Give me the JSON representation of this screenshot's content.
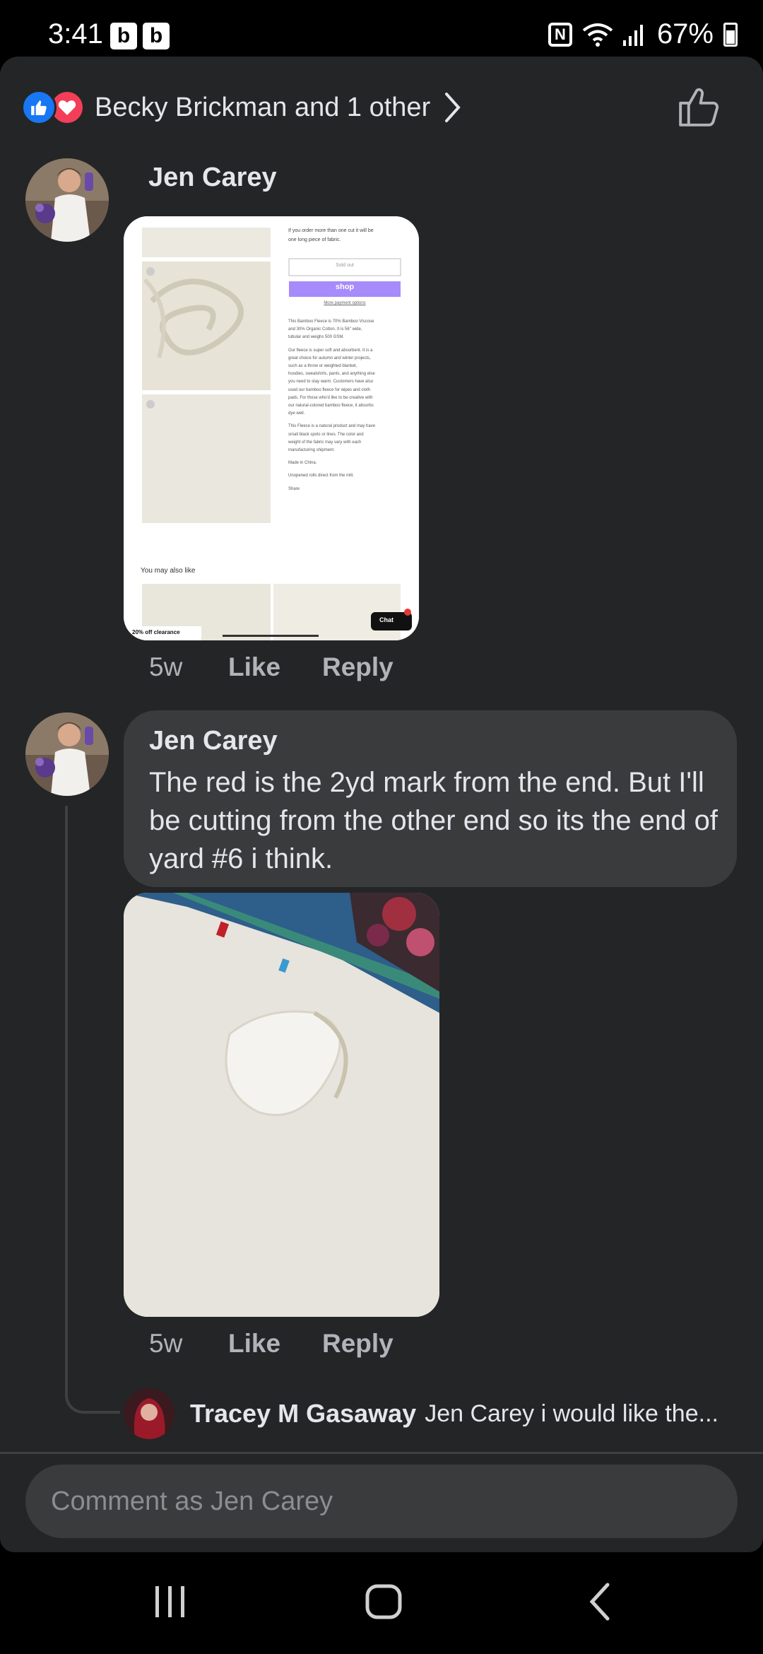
{
  "status_bar": {
    "time": "3:41",
    "badges": [
      "b",
      "b"
    ],
    "nfc": "N",
    "battery": "67%"
  },
  "header": {
    "reactions_text": "Becky Brickman and 1 other",
    "icons": [
      "like-reaction-icon",
      "love-reaction-icon",
      "chevron-right-icon",
      "like-outline-icon"
    ]
  },
  "comments": [
    {
      "author": "Jen Carey",
      "attachment": "screenshot",
      "screenshot": {
        "lines": [
          "If you order more than one cut it will be",
          "one long piece of fabric.",
          "Sold out",
          "More payment options",
          "This Bamboo Fleece is 70% Bamboo Viscose",
          "and 30% Organic Cotton. It is 56\" wide,",
          "tubular and weighs 500 GSM.",
          "Our fleece is super soft and absorbent. It is a",
          "great choice for autumn and winter projects,",
          "such as a throw or weighted blanket,",
          "hoodies, sweatshirts, pants, and anything else",
          "you need to stay warm. Customers have also",
          "used our bamboo fleece for wipes and cloth",
          "pads. For those who'd like to be creative with",
          "our natural-colored bamboo fleece, it absorbs",
          "dye well.",
          "This Fleece is a natural product and may have",
          "small black spots or lines. The color and",
          "weight of the fabric may vary with each",
          "manufacturing shipment.",
          "Made in China.",
          "Unopened rolls direct from the mill.",
          "Share"
        ],
        "shop_button": "shop",
        "also_like": "You may also like",
        "clearance": "20% off clearance",
        "chat": "Chat"
      },
      "time": "5w",
      "like": "Like",
      "reply": "Reply"
    },
    {
      "author": "Jen Carey",
      "text": "The red is the 2yd mark from the end. But I'll be cutting from the other end so its the end of yard #6 i think.",
      "attachment": "photo",
      "time": "5w",
      "like": "Like",
      "reply": "Reply"
    }
  ],
  "reply_preview": {
    "author": "Tracey M Gasaway",
    "text": "Jen Carey i would like the..."
  },
  "composer": {
    "placeholder": "Comment as Jen Carey"
  },
  "nav": {
    "icons": [
      "recents-icon",
      "home-icon",
      "back-icon"
    ]
  }
}
